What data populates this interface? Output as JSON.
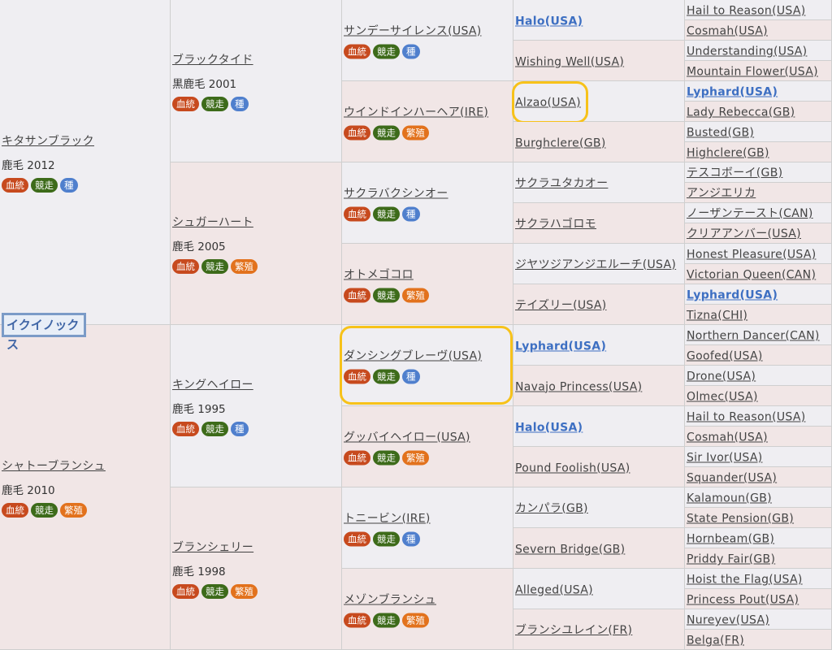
{
  "subject": "イクイノックス",
  "tags": {
    "blood": "血統",
    "race": "競走",
    "stud": "種",
    "breed": "繁殖"
  },
  "gen1": [
    {
      "name": "キタサンブラック",
      "info": "鹿毛 2012",
      "tags": [
        "blood",
        "race",
        "stud"
      ]
    },
    {
      "name": "シャトーブランシュ",
      "info": "鹿毛 2010",
      "tags": [
        "blood",
        "race",
        "breed"
      ]
    }
  ],
  "gen2": [
    {
      "name": "ブラックタイド",
      "info": "黒鹿毛 2001",
      "tags": [
        "blood",
        "race",
        "stud"
      ]
    },
    {
      "name": "シュガーハート",
      "info": "鹿毛 2005",
      "tags": [
        "blood",
        "race",
        "breed"
      ]
    },
    {
      "name": "キングヘイロー",
      "info": "鹿毛 1995",
      "tags": [
        "blood",
        "race",
        "stud"
      ]
    },
    {
      "name": "ブランシェリー",
      "info": "鹿毛 1998",
      "tags": [
        "blood",
        "race",
        "breed"
      ]
    }
  ],
  "gen3": [
    {
      "name": "サンデーサイレンス(USA)",
      "tags": [
        "blood",
        "race",
        "stud"
      ]
    },
    {
      "name": "ウインドインハーヘア(IRE)",
      "tags": [
        "blood",
        "race",
        "breed"
      ]
    },
    {
      "name": "サクラバクシンオー",
      "tags": [
        "blood",
        "race",
        "stud"
      ]
    },
    {
      "name": "オトメゴコロ",
      "tags": [
        "blood",
        "race",
        "breed"
      ]
    },
    {
      "name": "ダンシングブレーヴ(USA)",
      "tags": [
        "blood",
        "race",
        "stud"
      ]
    },
    {
      "name": "グッバイヘイロー(USA)",
      "tags": [
        "blood",
        "race",
        "breed"
      ]
    },
    {
      "name": "トニービン(IRE)",
      "tags": [
        "blood",
        "race",
        "stud"
      ]
    },
    {
      "name": "メゾンブランシュ",
      "tags": [
        "blood",
        "race",
        "breed"
      ]
    }
  ],
  "gen4": [
    {
      "name": "Halo(USA)",
      "strong": true
    },
    {
      "name": "Wishing Well(USA)"
    },
    {
      "name": "Alzao(USA)"
    },
    {
      "name": "Burghclere(GB)"
    },
    {
      "name": "サクラユタカオー"
    },
    {
      "name": "サクラハゴロモ"
    },
    {
      "name": "ジヤツジアンジエルーチ(USA)"
    },
    {
      "name": "テイズリー(USA)"
    },
    {
      "name": "Lyphard(USA)",
      "strong": true
    },
    {
      "name": "Navajo Princess(USA)"
    },
    {
      "name": "Halo(USA)",
      "strong": true
    },
    {
      "name": "Pound Foolish(USA)"
    },
    {
      "name": "カンパラ(GB)"
    },
    {
      "name": "Severn Bridge(GB)"
    },
    {
      "name": "Alleged(USA)"
    },
    {
      "name": "ブランシユレイン(FR)"
    }
  ],
  "gen5": [
    {
      "name": "Hail to Reason(USA)"
    },
    {
      "name": "Cosmah(USA)"
    },
    {
      "name": "Understanding(USA)"
    },
    {
      "name": "Mountain Flower(USA)"
    },
    {
      "name": "Lyphard(USA)",
      "strong": true
    },
    {
      "name": "Lady Rebecca(GB)"
    },
    {
      "name": "Busted(GB)"
    },
    {
      "name": "Highclere(GB)"
    },
    {
      "name": "テスコボーイ(GB)"
    },
    {
      "name": "アンジエリカ"
    },
    {
      "name": "ノーザンテースト(CAN)"
    },
    {
      "name": "クリアアンバー(USA)"
    },
    {
      "name": "Honest Pleasure(USA)"
    },
    {
      "name": "Victorian Queen(CAN)"
    },
    {
      "name": "Lyphard(USA)",
      "strong": true
    },
    {
      "name": "Tizna(CHI)"
    },
    {
      "name": "Northern Dancer(CAN)"
    },
    {
      "name": "Goofed(USA)"
    },
    {
      "name": "Drone(USA)"
    },
    {
      "name": "Olmec(USA)"
    },
    {
      "name": "Hail to Reason(USA)"
    },
    {
      "name": "Cosmah(USA)"
    },
    {
      "name": "Sir Ivor(USA)"
    },
    {
      "name": "Squander(USA)"
    },
    {
      "name": "Kalamoun(GB)"
    },
    {
      "name": "State Pension(GB)"
    },
    {
      "name": "Hornbeam(GB)"
    },
    {
      "name": "Priddy Fair(GB)"
    },
    {
      "name": "Hoist the Flag(USA)"
    },
    {
      "name": "Princess Pout(USA)"
    },
    {
      "name": "Nureyev(USA)"
    },
    {
      "name": "Belga(FR)"
    }
  ],
  "highlights": [
    "Alzao(USA)",
    "ダンシングブレーヴ(USA)"
  ]
}
